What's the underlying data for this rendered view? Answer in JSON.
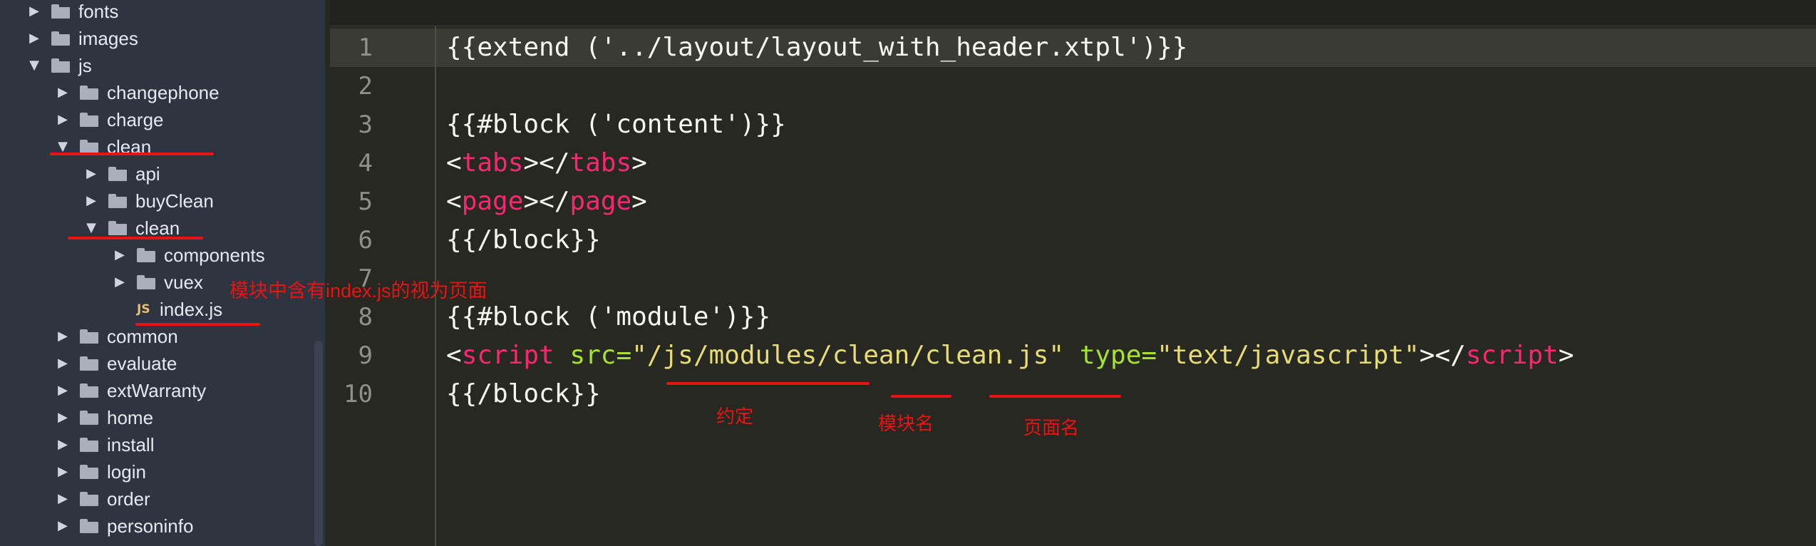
{
  "sidebar": {
    "rows": [
      {
        "name": "fonts",
        "arrow": "▶",
        "kind": "folder"
      },
      {
        "name": "images",
        "arrow": "▶",
        "kind": "folder"
      },
      {
        "name": "js",
        "arrow": "▼",
        "kind": "folder"
      },
      {
        "name": "changephone",
        "arrow": "▶",
        "kind": "folder"
      },
      {
        "name": "charge",
        "arrow": "▶",
        "kind": "folder"
      },
      {
        "name": "clean",
        "arrow": "▼",
        "kind": "folder"
      },
      {
        "name": "api",
        "arrow": "▶",
        "kind": "folder"
      },
      {
        "name": "buyClean",
        "arrow": "▶",
        "kind": "folder"
      },
      {
        "name": "clean",
        "arrow": "▼",
        "kind": "folder"
      },
      {
        "name": "components",
        "arrow": "▶",
        "kind": "folder"
      },
      {
        "name": "vuex",
        "arrow": "▶",
        "kind": "folder"
      },
      {
        "name": "index.js",
        "arrow": "",
        "kind": "file",
        "badge": "JS"
      },
      {
        "name": "common",
        "arrow": "▶",
        "kind": "folder"
      },
      {
        "name": "evaluate",
        "arrow": "▶",
        "kind": "folder"
      },
      {
        "name": "extWarranty",
        "arrow": "▶",
        "kind": "folder"
      },
      {
        "name": "home",
        "arrow": "▶",
        "kind": "folder"
      },
      {
        "name": "install",
        "arrow": "▶",
        "kind": "folder"
      },
      {
        "name": "login",
        "arrow": "▶",
        "kind": "folder"
      },
      {
        "name": "order",
        "arrow": "▶",
        "kind": "folder"
      },
      {
        "name": "personinfo",
        "arrow": "▶",
        "kind": "folder"
      }
    ]
  },
  "editor": {
    "line_numbers": [
      "1",
      "2",
      "3",
      "4",
      "5",
      "6",
      "7",
      "8",
      "9",
      "10"
    ],
    "line1": "{{extend ('../layout/layout_with_header.xtpl')}}",
    "line3": "{{#block ('content')}}",
    "line4": {
      "open": "<",
      "tag": "tabs",
      "mid": "></",
      "tag2": "tabs",
      "close": ">"
    },
    "line5": {
      "open": "<",
      "tag": "page",
      "mid": "></",
      "tag2": "page",
      "close": ">"
    },
    "line6": "{{/block}}",
    "line8": "{{#block ('module')}}",
    "line9": {
      "open": "<",
      "tag": "script",
      "sp1": " ",
      "attr1": "src=",
      "val1": "\"/js/modules/clean/clean.js\"",
      "sp2": " ",
      "attr2": "type=",
      "val2": "\"text/javascript\"",
      "mid": "></",
      "tag2": "script",
      "close": ">"
    },
    "line10": "{{/block}}"
  },
  "annotations": {
    "note_index": "模块中含有index.js的视为页面",
    "note_convention": "约定",
    "note_module_name": "模块名",
    "note_page_name": "页面名",
    "color": "#e81313"
  },
  "colors": {
    "sidebar_bg": "#2e3440",
    "editor_bg": "#272822",
    "keyword": "#f92672",
    "attribute": "#a6e22e",
    "string": "#e6db74"
  }
}
